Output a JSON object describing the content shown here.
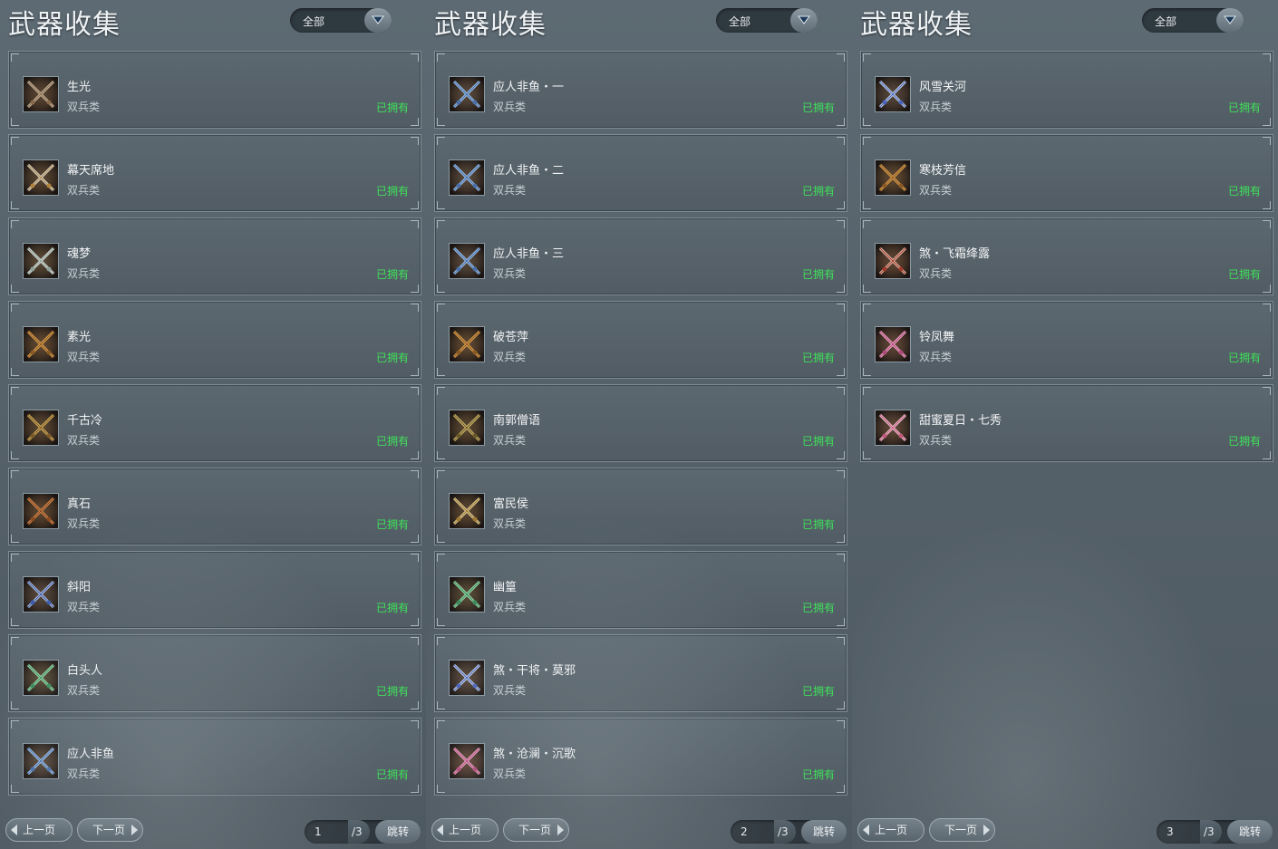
{
  "colors": {
    "owned": "#3fe05a",
    "panel_bg": "#56626a",
    "card_border": "#7f8d96"
  },
  "panels": [
    {
      "title": "武器收集",
      "filter": {
        "value": "全部",
        "icon": "chevron-down-icon"
      },
      "items": [
        {
          "name": "生光",
          "type": "双兵类",
          "status": "已拥有",
          "icon": "dragon-blade-icon"
        },
        {
          "name": "幕天席地",
          "type": "双兵类",
          "status": "已拥有",
          "icon": "curved-blade-icon"
        },
        {
          "name": "魂梦",
          "type": "双兵类",
          "status": "已拥有",
          "icon": "crossed-swords-icon"
        },
        {
          "name": "素光",
          "type": "双兵类",
          "status": "已拥有",
          "icon": "golden-crossed-blades-icon"
        },
        {
          "name": "千古冷",
          "type": "双兵类",
          "status": "已拥有",
          "icon": "twin-maces-icon"
        },
        {
          "name": "真石",
          "type": "双兵类",
          "status": "已拥有",
          "icon": "twin-hooks-icon"
        },
        {
          "name": "斜阳",
          "type": "双兵类",
          "status": "已拥有",
          "icon": "jeweled-blade-icon"
        },
        {
          "name": "白头人",
          "type": "双兵类",
          "status": "已拥有",
          "icon": "jade-crossed-swords-icon"
        },
        {
          "name": "应人非鱼",
          "type": "双兵类",
          "status": "已拥有",
          "icon": "blue-crossed-swords-icon"
        }
      ],
      "pager": {
        "prev": "上一页",
        "next": "下一页",
        "current": "1",
        "total": "/3",
        "jump": "跳转"
      }
    },
    {
      "title": "武器收集",
      "filter": {
        "value": "全部",
        "icon": "chevron-down-icon"
      },
      "items": [
        {
          "name": "应人非鱼・一",
          "type": "双兵类",
          "status": "已拥有",
          "icon": "blue-crossed-swords-icon"
        },
        {
          "name": "应人非鱼・二",
          "type": "双兵类",
          "status": "已拥有",
          "icon": "blue-crossed-swords-icon"
        },
        {
          "name": "应人非鱼・三",
          "type": "双兵类",
          "status": "已拥有",
          "icon": "blue-crossed-swords-icon"
        },
        {
          "name": "破苍萍",
          "type": "双兵类",
          "status": "已拥有",
          "icon": "golden-crossed-blades-icon"
        },
        {
          "name": "南郭僧语",
          "type": "双兵类",
          "status": "已拥有",
          "icon": "gold-crossed-daggers-icon"
        },
        {
          "name": "富民侯",
          "type": "双兵类",
          "status": "已拥有",
          "icon": "ornate-crossed-swords-icon"
        },
        {
          "name": "幽篁",
          "type": "双兵类",
          "status": "已拥有",
          "icon": "jade-crossed-swords-icon"
        },
        {
          "name": "煞・干将・莫邪",
          "type": "双兵类",
          "status": "已拥有",
          "icon": "crystal-crossed-swords-icon"
        },
        {
          "name": "煞・沧澜・沉歌",
          "type": "双兵类",
          "status": "已拥有",
          "icon": "pink-crossed-swords-icon"
        }
      ],
      "pager": {
        "prev": "上一页",
        "next": "下一页",
        "current": "2",
        "total": "/3",
        "jump": "跳转"
      }
    },
    {
      "title": "武器收集",
      "filter": {
        "value": "全部",
        "icon": "chevron-down-icon"
      },
      "items": [
        {
          "name": "风雪关河",
          "type": "双兵类",
          "status": "已拥有",
          "icon": "crystal-crossed-swords-icon"
        },
        {
          "name": "寒枝芳信",
          "type": "双兵类",
          "status": "已拥有",
          "icon": "golden-crossed-blades-icon"
        },
        {
          "name": "煞・飞霜绛露",
          "type": "双兵类",
          "status": "已拥有",
          "icon": "red-crossed-swords-icon"
        },
        {
          "name": "铃凤舞",
          "type": "双兵类",
          "status": "已拥有",
          "icon": "pink-crossed-swords-icon"
        },
        {
          "name": "甜蜜夏日・七秀",
          "type": "双兵类",
          "status": "已拥有",
          "icon": "flower-crossed-swords-icon"
        }
      ],
      "pager": {
        "prev": "上一页",
        "next": "下一页",
        "current": "3",
        "total": "/3",
        "jump": "跳转"
      }
    }
  ]
}
